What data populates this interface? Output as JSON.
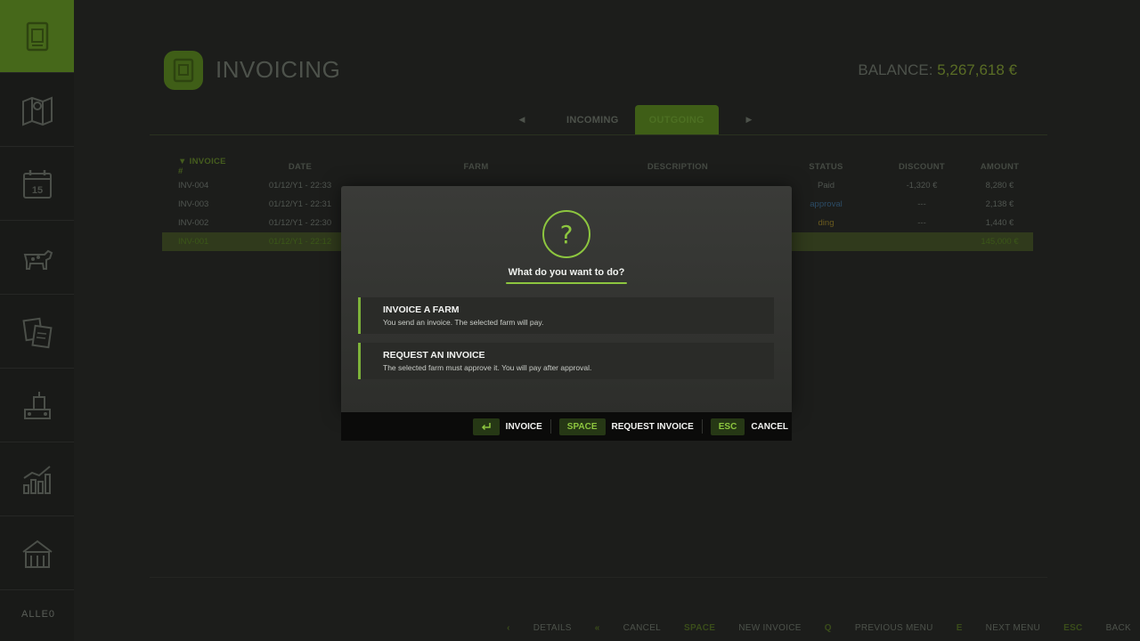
{
  "app": {
    "title": "INVOICING",
    "balance_label": "BALANCE:",
    "balance_value": "5,267,618 €"
  },
  "sidebar": {
    "items": [
      {
        "icon": "invoice-icon",
        "active": true
      },
      {
        "icon": "map-icon",
        "active": false
      },
      {
        "icon": "calendar-icon",
        "active": false,
        "text": "15"
      },
      {
        "icon": "animals-icon",
        "active": false
      },
      {
        "icon": "contracts-icon",
        "active": false
      },
      {
        "icon": "production-icon",
        "active": false
      },
      {
        "icon": "statistics-icon",
        "active": false
      },
      {
        "icon": "farm-icon",
        "active": false
      }
    ],
    "bottom_label": "ALLE0"
  },
  "tabs": {
    "items": [
      "INCOMING",
      "OUTGOING"
    ],
    "active": "OUTGOING"
  },
  "table": {
    "headers": [
      "INVOICE #",
      "DATE",
      "FARM",
      "DESCRIPTION",
      "STATUS",
      "DISCOUNT",
      "AMOUNT"
    ],
    "rows": [
      {
        "invoice": "INV-004",
        "date": "01/12/Y1 - 22:33",
        "farm": "",
        "description": "",
        "status": "Paid",
        "discount": "-1,320 €",
        "amount": "8,280 €"
      },
      {
        "invoice": "INV-003",
        "date": "01/12/Y1 - 22:31",
        "farm": "",
        "description": "",
        "status": "approval",
        "discount": "---",
        "amount": "2,138 €"
      },
      {
        "invoice": "INV-002",
        "date": "01/12/Y1 - 22:30",
        "farm": "",
        "description": "",
        "status": "ding",
        "discount": "---",
        "amount": "1,440 €"
      },
      {
        "invoice": "INV-001",
        "date": "01/12/Y1 - 22:12",
        "farm": "",
        "description": "",
        "status": "",
        "discount": "",
        "amount": "145,000 €"
      }
    ]
  },
  "footer": {
    "hints": [
      {
        "key": "‹",
        "label": "DETAILS"
      },
      {
        "key": "«",
        "label": "CANCEL"
      },
      {
        "key": "SPACE",
        "label": "NEW INVOICE"
      },
      {
        "key": "Q",
        "label": "PREVIOUS MENU"
      },
      {
        "key": "E",
        "label": "NEXT MENU"
      },
      {
        "key": "ESC",
        "label": "BACK"
      }
    ]
  },
  "modal": {
    "icon": "question-icon",
    "icon_glyph": "?",
    "question": "What do you want to do?",
    "options": [
      {
        "title": "INVOICE A FARM",
        "desc": "You send an invoice. The selected farm will pay."
      },
      {
        "title": "REQUEST AN INVOICE",
        "desc": "The selected farm must approve it. You will pay after approval."
      }
    ],
    "buttons": [
      {
        "key_icon": "enter-icon",
        "label": "INVOICE"
      },
      {
        "key": "SPACE",
        "label": "REQUEST INVOICE"
      },
      {
        "key": "ESC",
        "label": "CANCEL"
      }
    ]
  },
  "colors": {
    "accent": "#8dc63f",
    "dark_accent": "#46681a",
    "background": "#1c1d1b"
  }
}
